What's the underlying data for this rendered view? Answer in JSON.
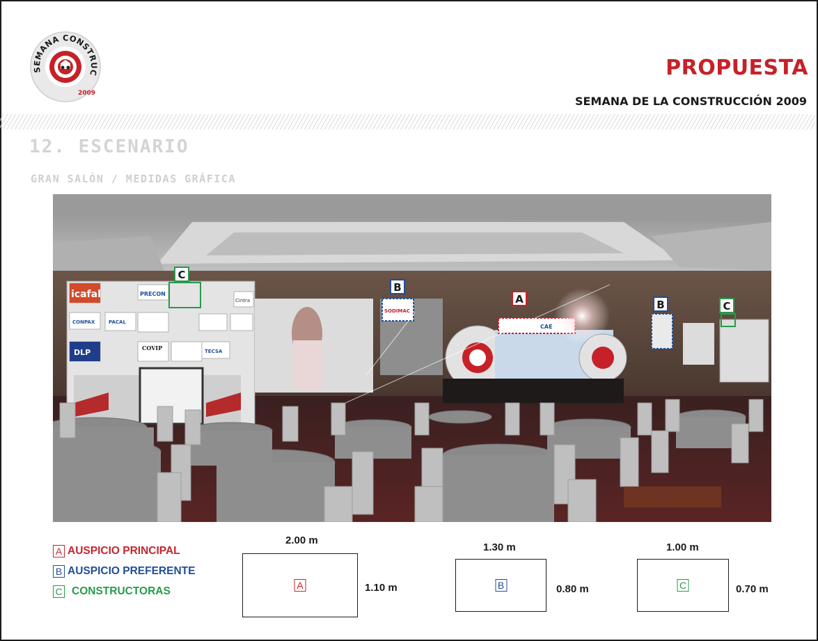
{
  "header": {
    "title": "PROPUESTA",
    "subtitle": "SEMANA DE LA CONSTRUCCIÓN 2009",
    "logo": {
      "ring_text": "SEMANA CONSTRUCCIÓN",
      "year": "2009"
    }
  },
  "section": {
    "title": "12. ESCENARIO",
    "subtitle": "GRAN SALÓN / MEDIDAS GRÁFICA"
  },
  "render": {
    "markers": [
      "C",
      "B",
      "A",
      "B",
      "C"
    ],
    "banners": [
      "icafal",
      "PRECON",
      "Cintra",
      "CONPAX",
      "PACAL",
      "COVIP",
      "DLP",
      "TECSA",
      "SODIMAC",
      "CAE"
    ]
  },
  "legend": [
    {
      "letter": "A",
      "label": "AUSPICIO PRINCIPAL",
      "color": "#c3272d"
    },
    {
      "letter": "B",
      "label": "AUSPICIO PREFERENTE",
      "color": "#1f4e9a"
    },
    {
      "letter": "C",
      "label": "CONSTRUCTORAS",
      "color": "#279a4b"
    }
  ],
  "dimensions": [
    {
      "letter": "A",
      "width": "2.00 m",
      "height": "1.10 m"
    },
    {
      "letter": "B",
      "width": "1.30 m",
      "height": "0.80 m"
    },
    {
      "letter": "C",
      "width": "1.00 m",
      "height": "0.70 m"
    }
  ]
}
